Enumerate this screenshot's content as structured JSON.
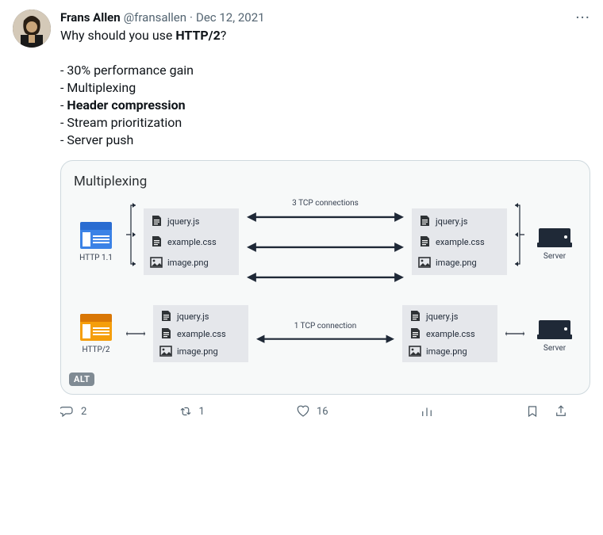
{
  "author": {
    "name": "Frans Allen",
    "handle": "@fransallen",
    "date": "Dec 12, 2021"
  },
  "text": {
    "line1_prefix": "Why should you use ",
    "line1_bold": "HTTP/2",
    "line1_suffix": "?",
    "bullet1": "- 30% performance gain",
    "bullet2": "- Multiplexing",
    "bullet3_prefix": "- ",
    "bullet3_bold": "Header compression",
    "bullet4": "- Stream prioritization",
    "bullet5": "- Server push"
  },
  "card": {
    "title": "Multiplexing",
    "alt_label": "ALT",
    "http11": {
      "label": "HTTP 1.1",
      "conn_label": "3 TCP connections",
      "server_label": "Server",
      "files": [
        "jquery.js",
        "example.css",
        "image.png"
      ]
    },
    "http2": {
      "label": "HTTP/2",
      "conn_label": "1 TCP connection",
      "server_label": "Server",
      "files": [
        "jquery.js",
        "example.css",
        "image.png"
      ]
    }
  },
  "actions": {
    "replies": "2",
    "retweets": "1",
    "likes": "16"
  }
}
